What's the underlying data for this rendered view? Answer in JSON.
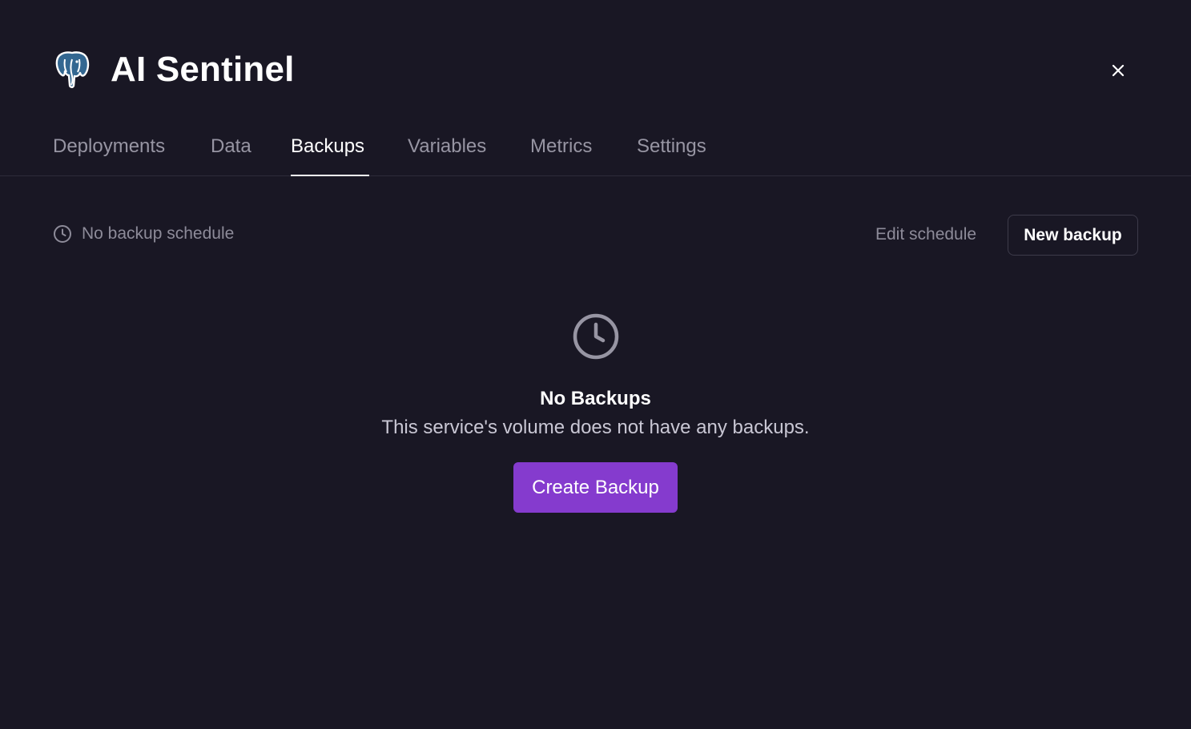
{
  "app": {
    "title": "AI Sentinel",
    "logo_icon": "postgres-elephant-icon"
  },
  "tabs": [
    {
      "label": "Deployments",
      "active": false
    },
    {
      "label": "Data",
      "active": false
    },
    {
      "label": "Backups",
      "active": true
    },
    {
      "label": "Variables",
      "active": false
    },
    {
      "label": "Metrics",
      "active": false
    },
    {
      "label": "Settings",
      "active": false
    }
  ],
  "toolbar": {
    "schedule_text": "No backup schedule",
    "schedule_icon": "clock-icon",
    "edit_schedule_label": "Edit schedule",
    "new_backup_label": "New backup"
  },
  "empty_state": {
    "icon": "clock-icon",
    "title": "No Backups",
    "description": "This service's volume does not have any backups.",
    "button_label": "Create Backup"
  },
  "colors": {
    "background": "#191724",
    "accent": "#853bce",
    "muted_text": "#9795a3"
  }
}
